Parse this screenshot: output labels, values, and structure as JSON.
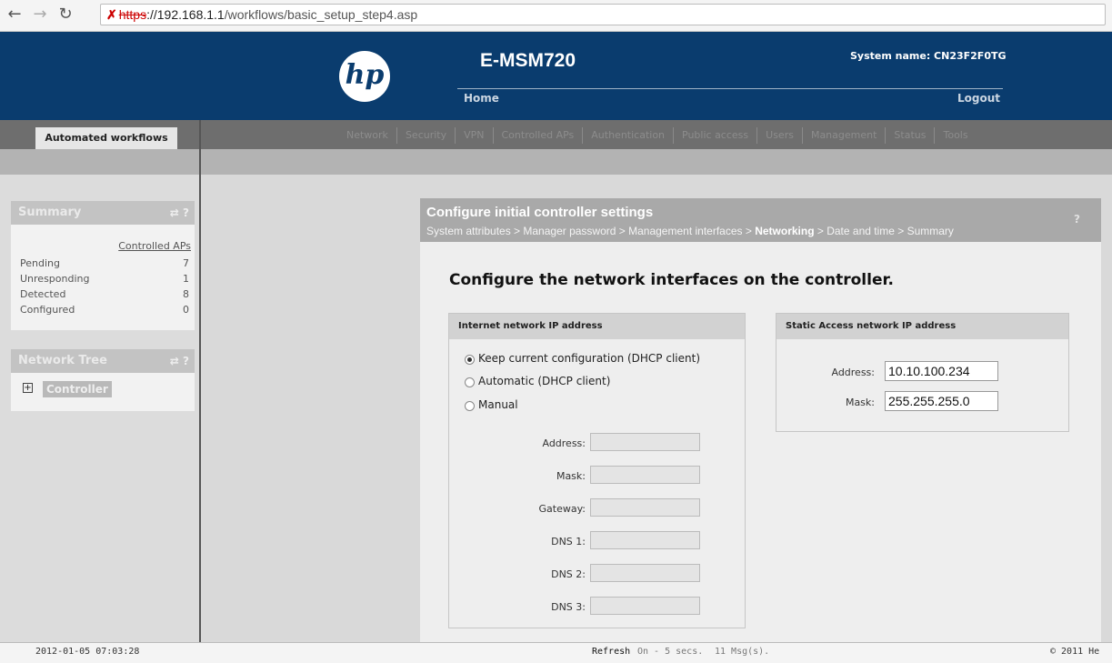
{
  "browser": {
    "url_scheme": "https",
    "url_host": "://192.168.1.1",
    "url_path": "/workflows/basic_setup_step4.asp"
  },
  "header": {
    "logo_text": "hp",
    "product": "E-MSM720",
    "system_name": "System name: CN23F2F0TG",
    "home": "Home",
    "logout": "Logout"
  },
  "tabs": {
    "active": "Automated workflows",
    "nav": [
      "Network",
      "Security",
      "VPN",
      "Controlled APs",
      "Authentication",
      "Public access",
      "Users",
      "Management",
      "Status",
      "Tools"
    ]
  },
  "sidebar": {
    "summary_title": "Summary",
    "summary_header": "Controlled APs",
    "summary_rows": [
      {
        "label": "Pending",
        "value": "7"
      },
      {
        "label": "Unresponding",
        "value": "1"
      },
      {
        "label": "Detected",
        "value": "8"
      },
      {
        "label": "Configured",
        "value": "0"
      }
    ],
    "tree_title": "Network Tree",
    "tree_node": "Controller",
    "panel_icons": "⇄ ?"
  },
  "main": {
    "panel_title": "Configure initial controller settings",
    "breadcrumb_before": "System attributes > Manager password > Management interfaces > ",
    "breadcrumb_current": "Networking",
    "breadcrumb_after": " > Date and time > Summary",
    "help": "?",
    "heading": "Configure the network interfaces on the controller.",
    "internet_box": {
      "title": "Internet network IP address",
      "options": [
        {
          "label": "Keep current configuration (DHCP client)",
          "selected": true
        },
        {
          "label": "Automatic (DHCP client)",
          "selected": false
        },
        {
          "label": "Manual",
          "selected": false
        }
      ],
      "fields": [
        {
          "label": "Address:",
          "value": ""
        },
        {
          "label": "Mask:",
          "value": ""
        },
        {
          "label": "Gateway:",
          "value": ""
        },
        {
          "label": "DNS 1:",
          "value": ""
        },
        {
          "label": "DNS 2:",
          "value": ""
        },
        {
          "label": "DNS 3:",
          "value": ""
        }
      ]
    },
    "static_box": {
      "title": "Static Access network IP address",
      "address_label": "Address:",
      "address_value": "10.10.100.234",
      "mask_label": "Mask:",
      "mask_value": "255.255.255.0"
    }
  },
  "statusbar": {
    "datetime": "2012-01-05 07:03:28",
    "refresh_label": "Refresh",
    "refresh_value": "On - 5 secs.",
    "messages": "11 Msg(s).",
    "copyright": "© 2011 He"
  }
}
